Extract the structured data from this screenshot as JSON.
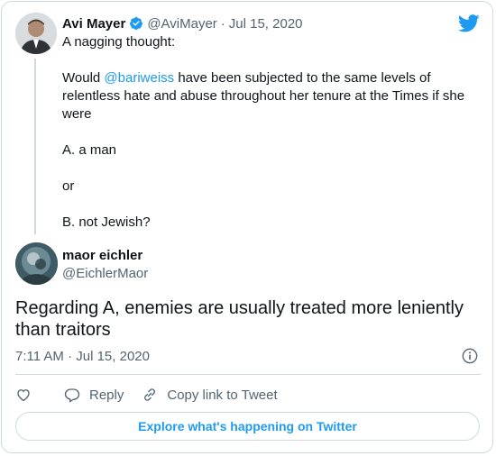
{
  "quoted_tweet": {
    "author_name": "Avi Mayer",
    "author_handle": "@AviMayer",
    "separator": "·",
    "date": "Jul 15, 2020",
    "line1": "A nagging thought:",
    "line2_prefix": "Would ",
    "mention": "@bariweiss",
    "line2_suffix": " have been subjected to the same levels of relentless hate and abuse throughout her tenure at the Times if she were",
    "option_a": "A. a man",
    "or": "or",
    "option_b": "B. not Jewish?"
  },
  "reply_tweet": {
    "author_name": "maor eichler",
    "author_handle": "@EichlerMaor",
    "text": "Regarding A, enemies are usually treated more leniently than traitors",
    "timestamp": "7:11 AM · Jul 15, 2020"
  },
  "actions": {
    "reply": "Reply",
    "copy_link": "Copy link to Tweet"
  },
  "explore_button": "Explore what's happening on Twitter",
  "colors": {
    "accent": "#1d9bf0",
    "text": "#0f1419",
    "muted": "#536471",
    "border": "#cfd9de"
  },
  "icons": [
    "verified-badge-icon",
    "twitter-bird-icon",
    "info-icon",
    "like-heart-icon",
    "reply-icon",
    "copy-link-icon"
  ]
}
